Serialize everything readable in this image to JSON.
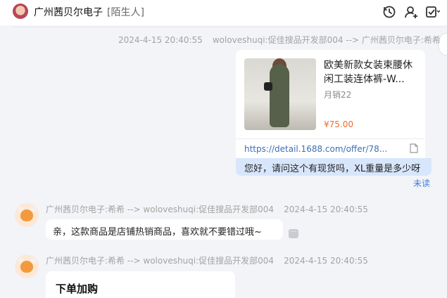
{
  "header": {
    "shop_name": "广州茜贝尔电子",
    "stranger_tag": "[陌生人]"
  },
  "messages": [
    {
      "time": "2024-4-15 20:40:55",
      "route": "woloveshuqi:促佳搜品开发部004 --> 广州茜贝尔电子:希希"
    },
    {
      "time": "2024-4-15 20:40:55",
      "route": "广州茜贝尔电子:希希 --> woloveshuqi:促佳搜品开发部004"
    },
    {
      "time": "2024-4-15 20:40:55",
      "route": "广州茜贝尔电子:希希 --> woloveshuqi:促佳搜品开发部004"
    }
  ],
  "product_card": {
    "title": "欧美新款女装束腰休闲工装连体裤-W...",
    "sales": "月销22",
    "price": "¥75.00",
    "link": "https://detail.1688.com/offer/78..."
  },
  "outgoing_text": "您好，请问这个有现货吗，XL重量是多少呀",
  "read_status": "未读",
  "reply_text": "亲，这款商品是店铺热销商品，喜欢就不要错过哦~",
  "more_label": "···",
  "order_card_title": "下单加购"
}
